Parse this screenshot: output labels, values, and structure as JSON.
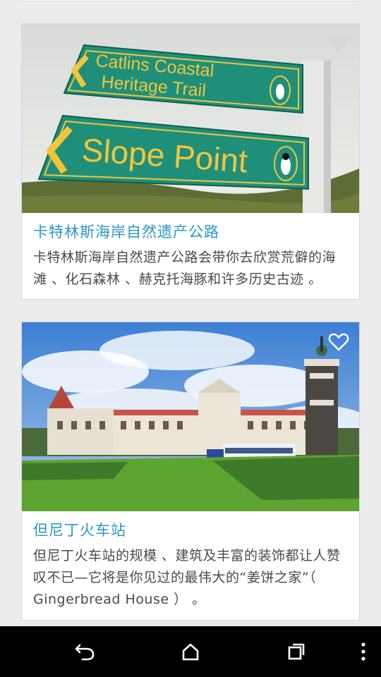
{
  "cards": [
    {
      "title": "卡特林斯海岸自然遗产公路",
      "description": "卡特林斯海岸自然遗产公路会带你去欣赏荒僻的海滩 、化石森林 、赫克托海豚和许多历史古迹 。",
      "sign_top_line1": "Catlins Coastal",
      "sign_top_line2": "Heritage Trail",
      "sign_bottom": "Slope Point",
      "favorite_icon": "heart-filled-icon"
    },
    {
      "title": "但尼丁火车站",
      "description": "但尼丁火车站的规模 、建筑及丰富的装饰都让人赞叹不已—它将是你见过的最伟大的“姜饼之家”（ Gingerbread House ） 。",
      "favorite_icon": "heart-outline-icon"
    }
  ],
  "navbar": {
    "icons": [
      "back-icon",
      "home-icon",
      "recents-icon",
      "overflow-menu-icon"
    ]
  },
  "colors": {
    "title": "#2a96c9",
    "background": "#ececec",
    "sign_green": "#1f8f7a",
    "sign_text": "#f0c63a"
  }
}
